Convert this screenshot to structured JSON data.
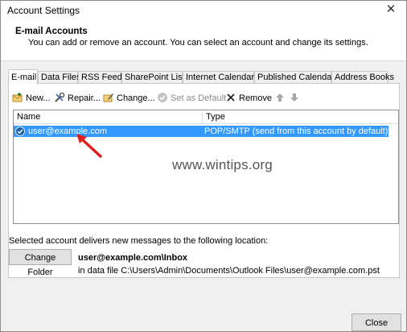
{
  "window": {
    "title": "Account Settings",
    "close_glyph": "✕"
  },
  "header": {
    "title": "E-mail Accounts",
    "description": "You can add or remove an account. You can select an account and change its settings."
  },
  "tabs": [
    {
      "label": "E-mail",
      "active": true
    },
    {
      "label": "Data Files"
    },
    {
      "label": "RSS Feeds"
    },
    {
      "label": "SharePoint Lists"
    },
    {
      "label": "Internet Calendars"
    },
    {
      "label": "Published Calendars"
    },
    {
      "label": "Address Books"
    }
  ],
  "toolbar": {
    "new_label": "New...",
    "repair_label": "Repair...",
    "change_label": "Change...",
    "set_default_label": "Set as Default",
    "remove_label": "Remove"
  },
  "accounts_list": {
    "columns": {
      "name": "Name",
      "type": "Type"
    },
    "rows": [
      {
        "name": "user@example.com",
        "type": "POP/SMTP (send from this account by default)",
        "selected": true,
        "default": true
      }
    ]
  },
  "watermark": "www.wintips.org",
  "delivery": {
    "text": "Selected account delivers new messages to the following location:",
    "change_folder_label": "Change Folder",
    "folder": "user@example.com\\Inbox",
    "data_file": "in data file C:\\Users\\Admin\\Documents\\Outlook Files\\user@example.com.pst"
  },
  "footer": {
    "close_label": "Close"
  },
  "colors": {
    "selection": "#3399ff",
    "arrow": "#e02020"
  }
}
